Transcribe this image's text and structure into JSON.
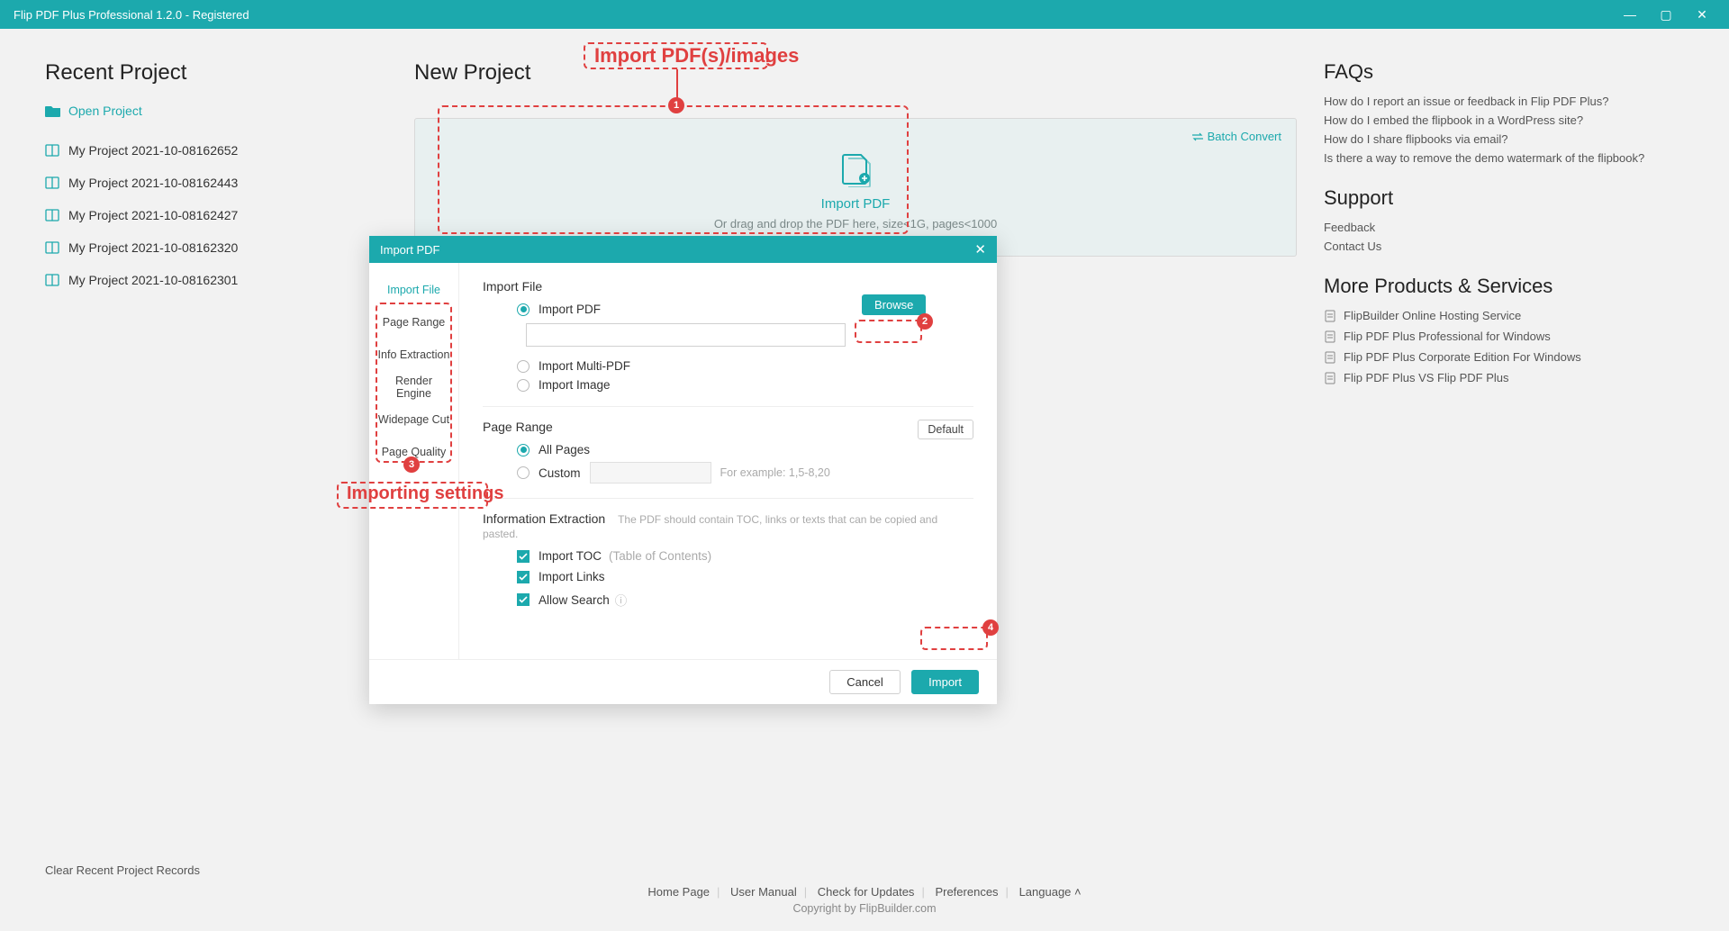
{
  "window": {
    "title": "Flip PDF Plus Professional 1.2.0 - Registered"
  },
  "left": {
    "heading": "Recent Project",
    "open": "Open Project",
    "projects": [
      "My Project 2021-10-08162652",
      "My Project 2021-10-08162443",
      "My Project 2021-10-08162427",
      "My Project 2021-10-08162320",
      "My Project 2021-10-08162301"
    ],
    "clear": "Clear Recent Project Records"
  },
  "center": {
    "heading": "New Project",
    "batch": "Batch Convert",
    "import_label": "Import PDF",
    "import_hint": "Or drag and drop the PDF here, size<1G, pages<1000"
  },
  "right": {
    "faqs_h": "FAQs",
    "faqs": [
      "How do I report an issue or feedback in Flip PDF Plus?",
      "How do I embed the flipbook in a WordPress site?",
      "How do I share flipbooks via email?",
      "Is there a way to remove the demo watermark of the flipbook?"
    ],
    "support_h": "Support",
    "support": [
      "Feedback",
      "Contact Us"
    ],
    "products_h": "More Products & Services",
    "products": [
      "FlipBuilder Online Hosting Service",
      "Flip PDF Plus Professional for Windows",
      "Flip PDF Plus Corporate Edition For Windows",
      "Flip PDF Plus VS Flip PDF Plus"
    ]
  },
  "dialog": {
    "title": "Import PDF",
    "tabs": [
      "Import File",
      "Page Range",
      "Info Extraction",
      "Render Engine",
      "Widepage Cut",
      "Page Quality"
    ],
    "s1": "Import File",
    "r1": "Import PDF",
    "r2": "Import Multi-PDF",
    "r3": "Import Image",
    "browse": "Browse",
    "s2": "Page Range",
    "default": "Default",
    "all": "All Pages",
    "custom": "Custom",
    "customHint": "For example: 1,5-8,20",
    "s3": "Information Extraction",
    "s3note": "The PDF should contain TOC, links or texts that can be copied and pasted.",
    "c1": "Import TOC",
    "c1h": "(Table of Contents)",
    "c2": "Import Links",
    "c3": "Allow Search",
    "cancel": "Cancel",
    "import": "Import"
  },
  "annot": {
    "a1": "Import PDF(s)/images",
    "a2": "Importing settings",
    "n1": "1",
    "n2": "2",
    "n3": "3",
    "n4": "4"
  },
  "footer": {
    "links": [
      "Home Page",
      "User Manual",
      "Check for Updates",
      "Preferences",
      "Language"
    ],
    "copy": "Copyright by FlipBuilder.com"
  }
}
